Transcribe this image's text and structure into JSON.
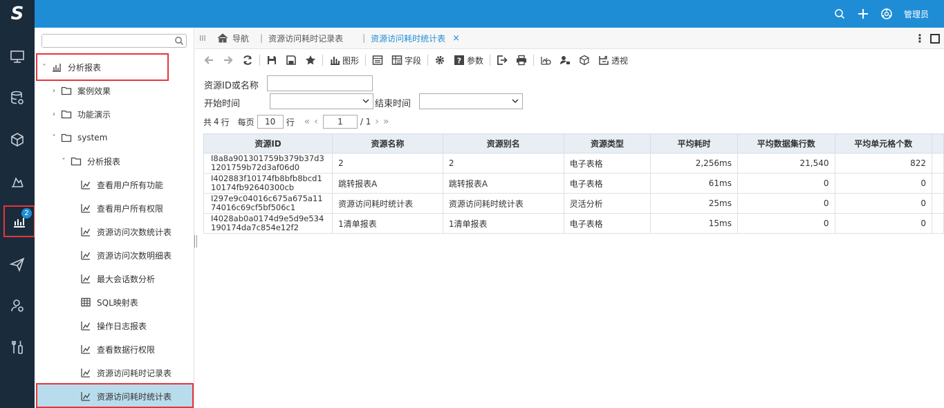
{
  "header": {
    "logo": "S",
    "user": "管理员"
  },
  "rail": {
    "badge": "2"
  },
  "tree": {
    "nodes": [
      {
        "label": "分析报表"
      },
      {
        "label": "案例效果"
      },
      {
        "label": "功能演示"
      },
      {
        "label": "system"
      },
      {
        "label": "分析报表"
      },
      {
        "label": "查看用户所有功能"
      },
      {
        "label": "查看用户所有权限"
      },
      {
        "label": "资源访问次数统计表"
      },
      {
        "label": "资源访问次数明细表"
      },
      {
        "label": "最大会话数分析"
      },
      {
        "label": "SQL映射表"
      },
      {
        "label": "操作日志报表"
      },
      {
        "label": "查看数据行权限"
      },
      {
        "label": "资源访问耗时记录表"
      },
      {
        "label": "资源访问耗时统计表"
      }
    ]
  },
  "tabs": [
    {
      "label": "导航"
    },
    {
      "label": "资源访问耗时记录表"
    },
    {
      "label": "资源访问耗时统计表"
    }
  ],
  "toolbar": {
    "chart": "图形",
    "fields": "字段",
    "params": "参数",
    "pivot": "透视"
  },
  "params": {
    "resource_label": "资源ID或名称",
    "resource_value": "",
    "start_label": "开始时间",
    "start_value": "",
    "end_label": "结束时间",
    "end_value": ""
  },
  "pager": {
    "total_prefix": "共",
    "total": "4",
    "total_suffix": "行",
    "per_page_label": "每页",
    "per_page": "10",
    "per_page_suffix": "行",
    "page": "1",
    "page_total": "/ 1"
  },
  "table": {
    "headers": [
      "资源ID",
      "资源名称",
      "资源别名",
      "资源类型",
      "平均耗时",
      "平均数据集行数",
      "平均单元格个数"
    ],
    "rows": [
      [
        "I8a8a901301759b379b37d31201759b72d3af06d0",
        "2",
        "2",
        "电子表格",
        "2,256ms",
        "21,540",
        "822"
      ],
      [
        "I402883f10174fb8bfb8bcd110174fb92640300cb",
        "跳转报表A",
        "跳转报表A",
        "电子表格",
        "61ms",
        "0",
        "0"
      ],
      [
        "I297e9c04016c675a675a1174016c69cf5bf506c1",
        "资源访问耗时统计表",
        "资源访问耗时统计表",
        "灵活分析",
        "25ms",
        "0",
        "0"
      ],
      [
        "I4028ab0a0174d9e5d9e534190174da7c854e12f2",
        "1清单报表",
        "1清单报表",
        "电子表格",
        "15ms",
        "0",
        "0"
      ]
    ]
  }
}
